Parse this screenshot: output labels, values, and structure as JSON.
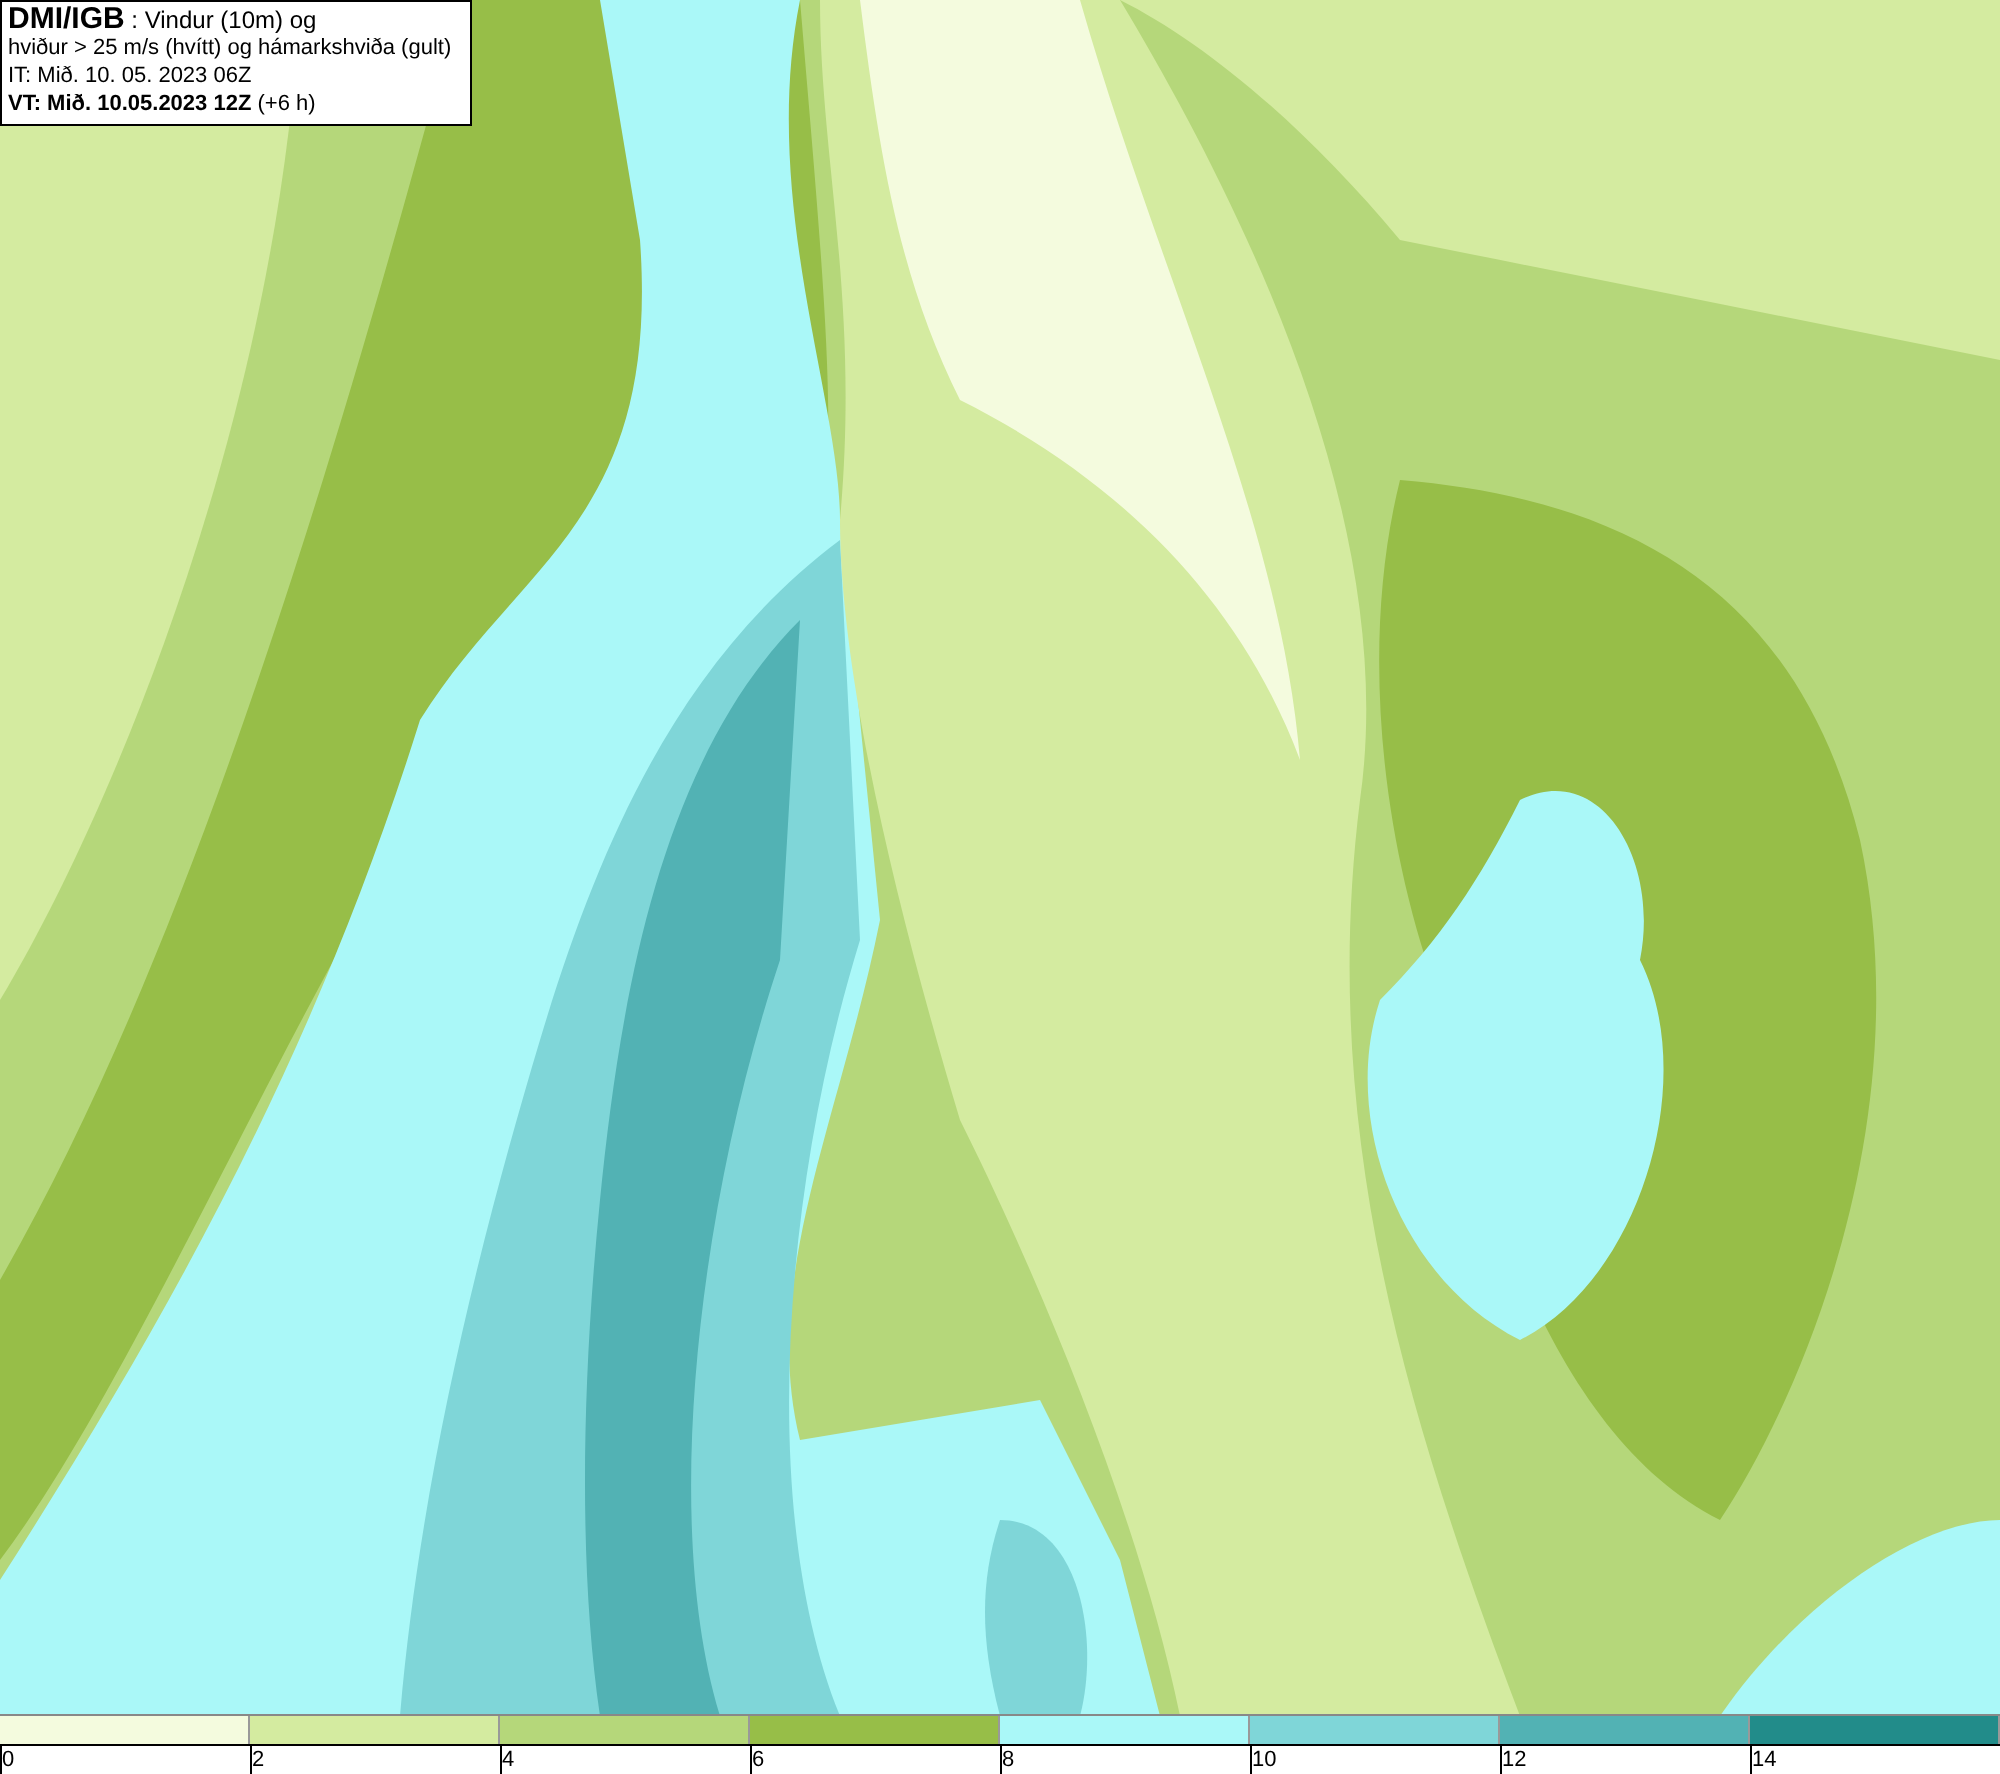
{
  "title_box": {
    "lines": [
      "**DMI/IGB** : Vindur (10m) og",
      "hviður > 25 m/s (hvítt) og hámarkshviða (gult)",
      "IT: Mið. 10. 05. 2023 06Z",
      "**VT: Mið. 10.05.2023 12Z** (+6 h)"
    ]
  },
  "legend": {
    "bins": [
      {
        "color": "#f4fbde"
      },
      {
        "color": "#d4eba0"
      },
      {
        "color": "#b5d77a"
      },
      {
        "color": "#97be48"
      },
      {
        "color": "#aaf8f8"
      },
      {
        "color": "#7fd6d8"
      },
      {
        "color": "#52b2b4"
      },
      {
        "color": "#228c8a"
      }
    ],
    "ticks": [
      "0",
      "2",
      "4",
      "6",
      "8",
      "10",
      "12",
      "14"
    ]
  }
}
